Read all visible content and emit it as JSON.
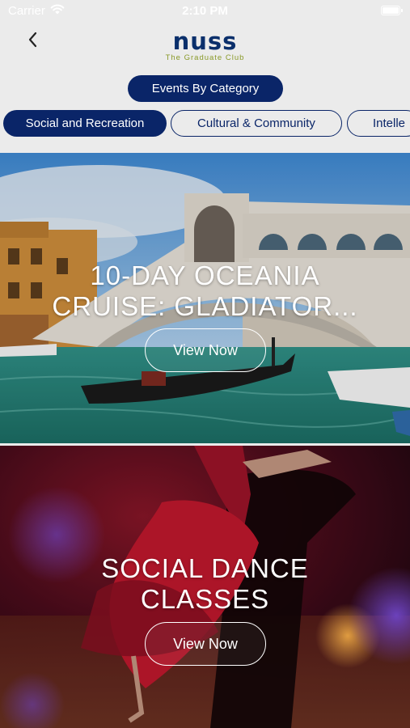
{
  "status_bar": {
    "carrier": "Carrier",
    "time": "2:10 PM"
  },
  "header": {
    "logo_text": "nuss",
    "logo_tagline": "The Graduate Club"
  },
  "category_heading": "Events By Category",
  "chips": [
    {
      "label": "Social and Recreation",
      "active": true
    },
    {
      "label": "Cultural & Community",
      "active": false
    },
    {
      "label": "Intelle",
      "active": false
    }
  ],
  "events": [
    {
      "title_line1": "10-DAY OCEANIA",
      "title_line2": "CRUISE: GLADIATOR...",
      "button_label": "View Now"
    },
    {
      "title_line1": "SOCIAL DANCE",
      "title_line2": "CLASSES",
      "button_label": "View Now"
    }
  ],
  "colors": {
    "navy": "#0a2568",
    "logo_blue": "#0a2f6b",
    "tagline_olive": "#8a9a2a",
    "background": "#ebebeb"
  },
  "icons": {
    "back": "chevron-left-icon",
    "wifi": "wifi-icon",
    "battery": "battery-icon"
  }
}
